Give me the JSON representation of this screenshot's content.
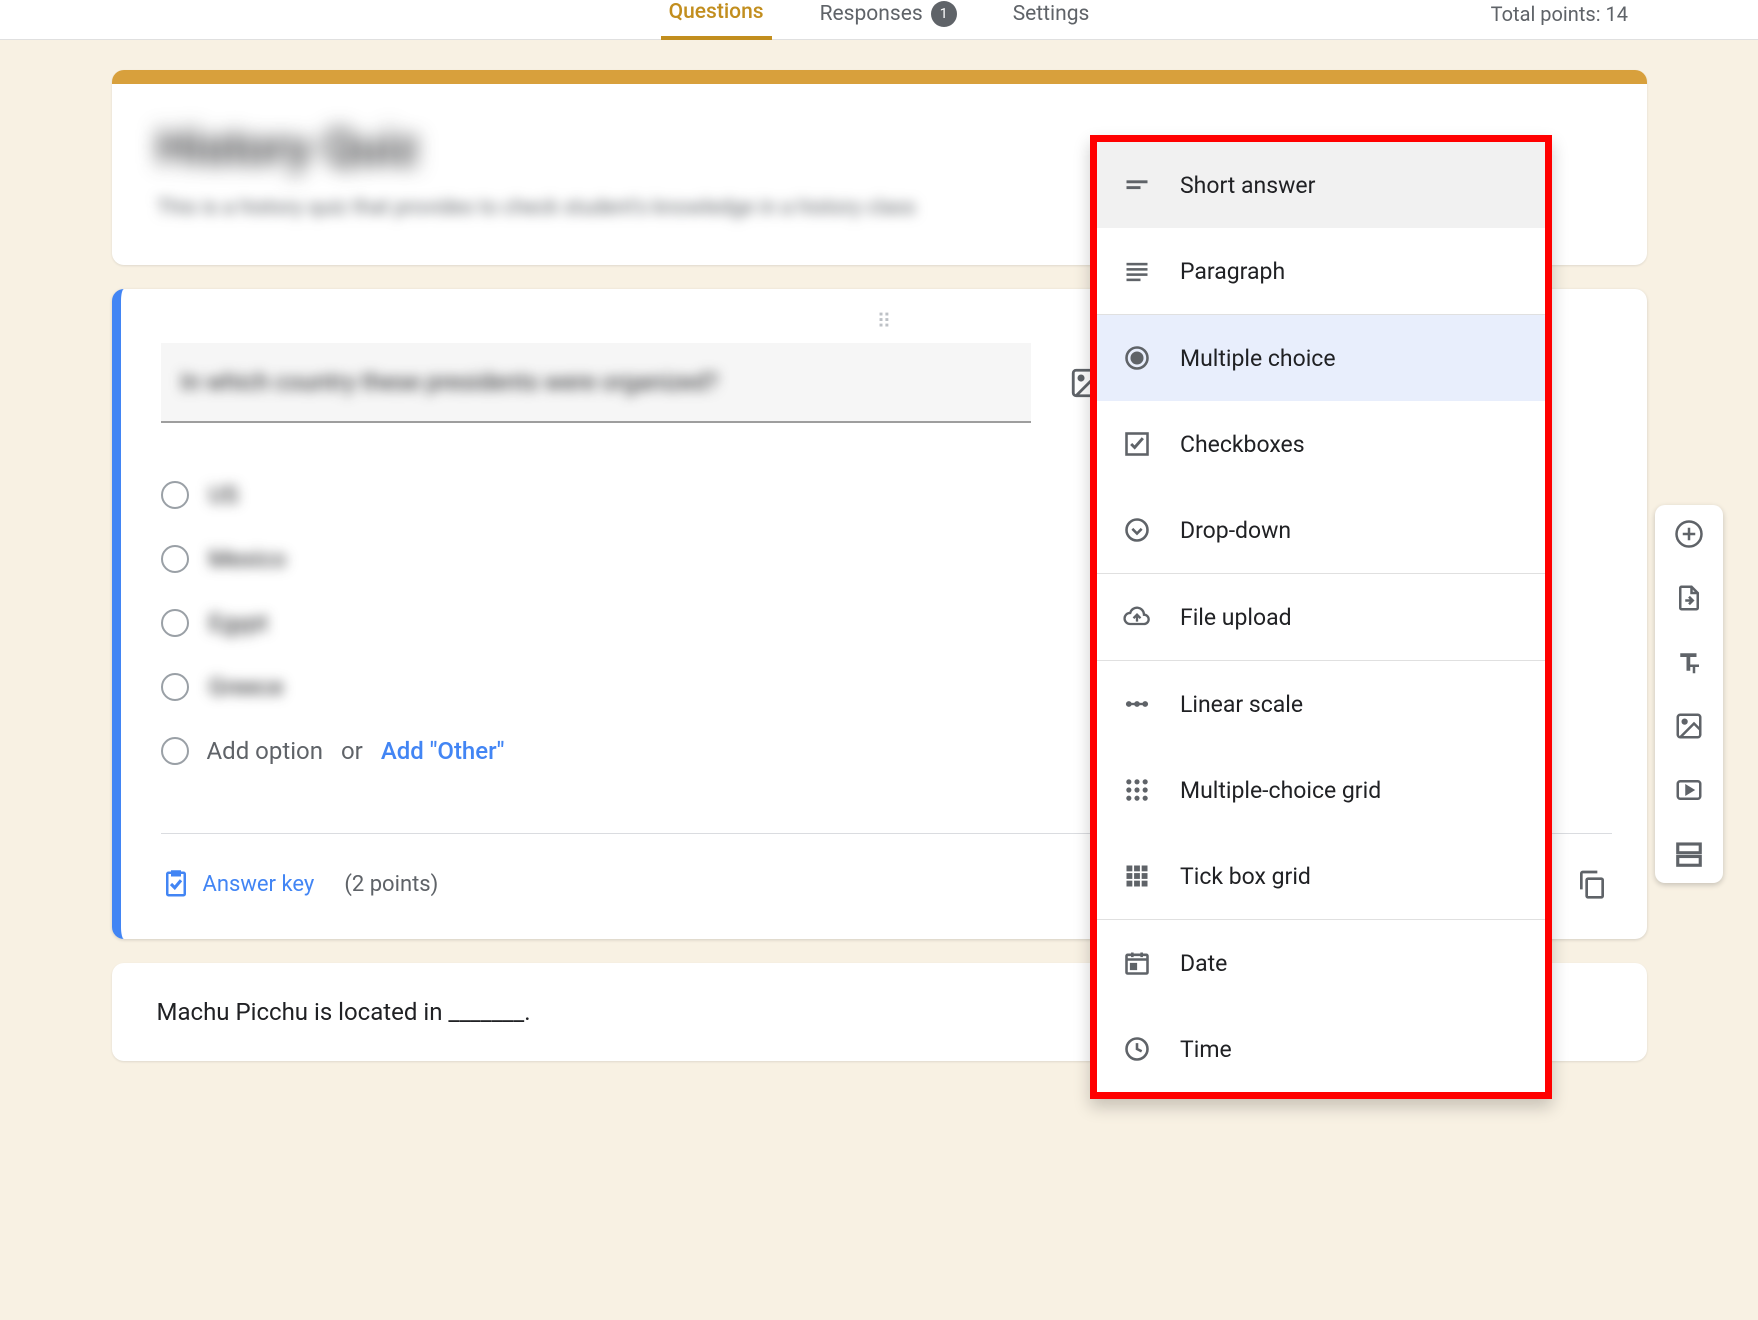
{
  "tabs": {
    "questions": "Questions",
    "responses": "Responses",
    "responses_count": "1",
    "settings": "Settings"
  },
  "total_points": "Total points: 14",
  "header": {
    "title": "History Quiz",
    "description": "This is a history quiz that provides to check student's knowledge in a history class"
  },
  "question": {
    "text": "In which country these presidents were organized?",
    "options": [
      "US",
      "Mexico",
      "Egypt",
      "Greece"
    ],
    "add_option": "Add option",
    "or": "or",
    "add_other": "Add \"Other\"",
    "answer_key": "Answer key",
    "points": "(2 points)"
  },
  "next_question": "Machu Picchu is located in _______.",
  "type_menu": {
    "short_answer": "Short answer",
    "paragraph": "Paragraph",
    "multiple_choice": "Multiple choice",
    "checkboxes": "Checkboxes",
    "drop_down": "Drop-down",
    "file_upload": "File upload",
    "linear_scale": "Linear scale",
    "mc_grid": "Multiple-choice grid",
    "tick_box_grid": "Tick box grid",
    "date": "Date",
    "time": "Time"
  }
}
